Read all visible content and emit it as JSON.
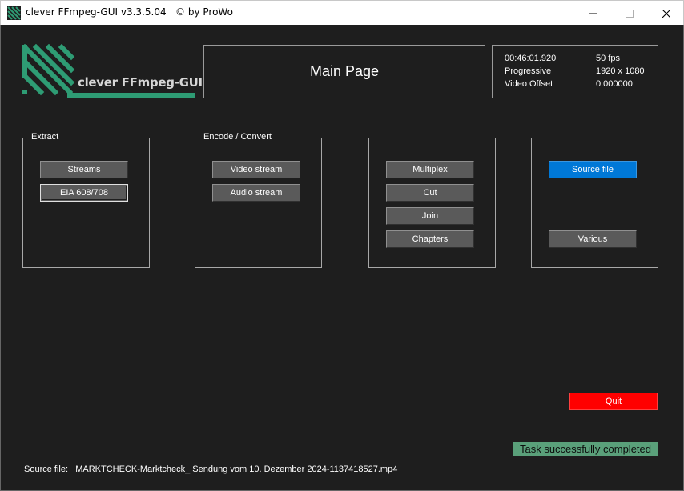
{
  "window": {
    "title": "clever FFmpeg-GUI v3.3.5.04   © by ProWo"
  },
  "logo": {
    "text": "clever FFmpeg-GUI"
  },
  "header": {
    "page_title": "Main Page"
  },
  "info": {
    "duration": "00:46:01.920",
    "fps": "50 fps",
    "scan_type": "Progressive",
    "resolution": "1920 x 1080",
    "video_offset_label": "Video Offset",
    "video_offset_value": "0.000000"
  },
  "groups": {
    "extract": {
      "label": "Extract",
      "streams": "Streams",
      "eia": "EIA 608/708"
    },
    "encode": {
      "label": "Encode / Convert",
      "video": "Video stream",
      "audio": "Audio stream"
    },
    "tools": {
      "multiplex": "Multiplex",
      "cut": "Cut",
      "join": "Join",
      "chapters": "Chapters"
    },
    "file": {
      "source": "Source file",
      "various": "Various"
    }
  },
  "actions": {
    "quit": "Quit"
  },
  "status": {
    "message": "Task successfully completed"
  },
  "footer": {
    "source_label": "Source file:",
    "source_value": "MARKTCHECK-Marktcheck_ Sendung vom 10. Dezember 2024-1137418527.mp4"
  },
  "colors": {
    "background": "#1e1e1e",
    "logo_green": "#2e9c74",
    "button_gray": "#5a5a5a",
    "primary_blue": "#0078d7",
    "quit_red": "#ff0000",
    "status_green": "#5aa07a"
  },
  "icons": {
    "app": "ffmpeg-logo-icon",
    "minimize": "minimize-icon",
    "maximize": "maximize-icon",
    "close": "close-icon"
  }
}
